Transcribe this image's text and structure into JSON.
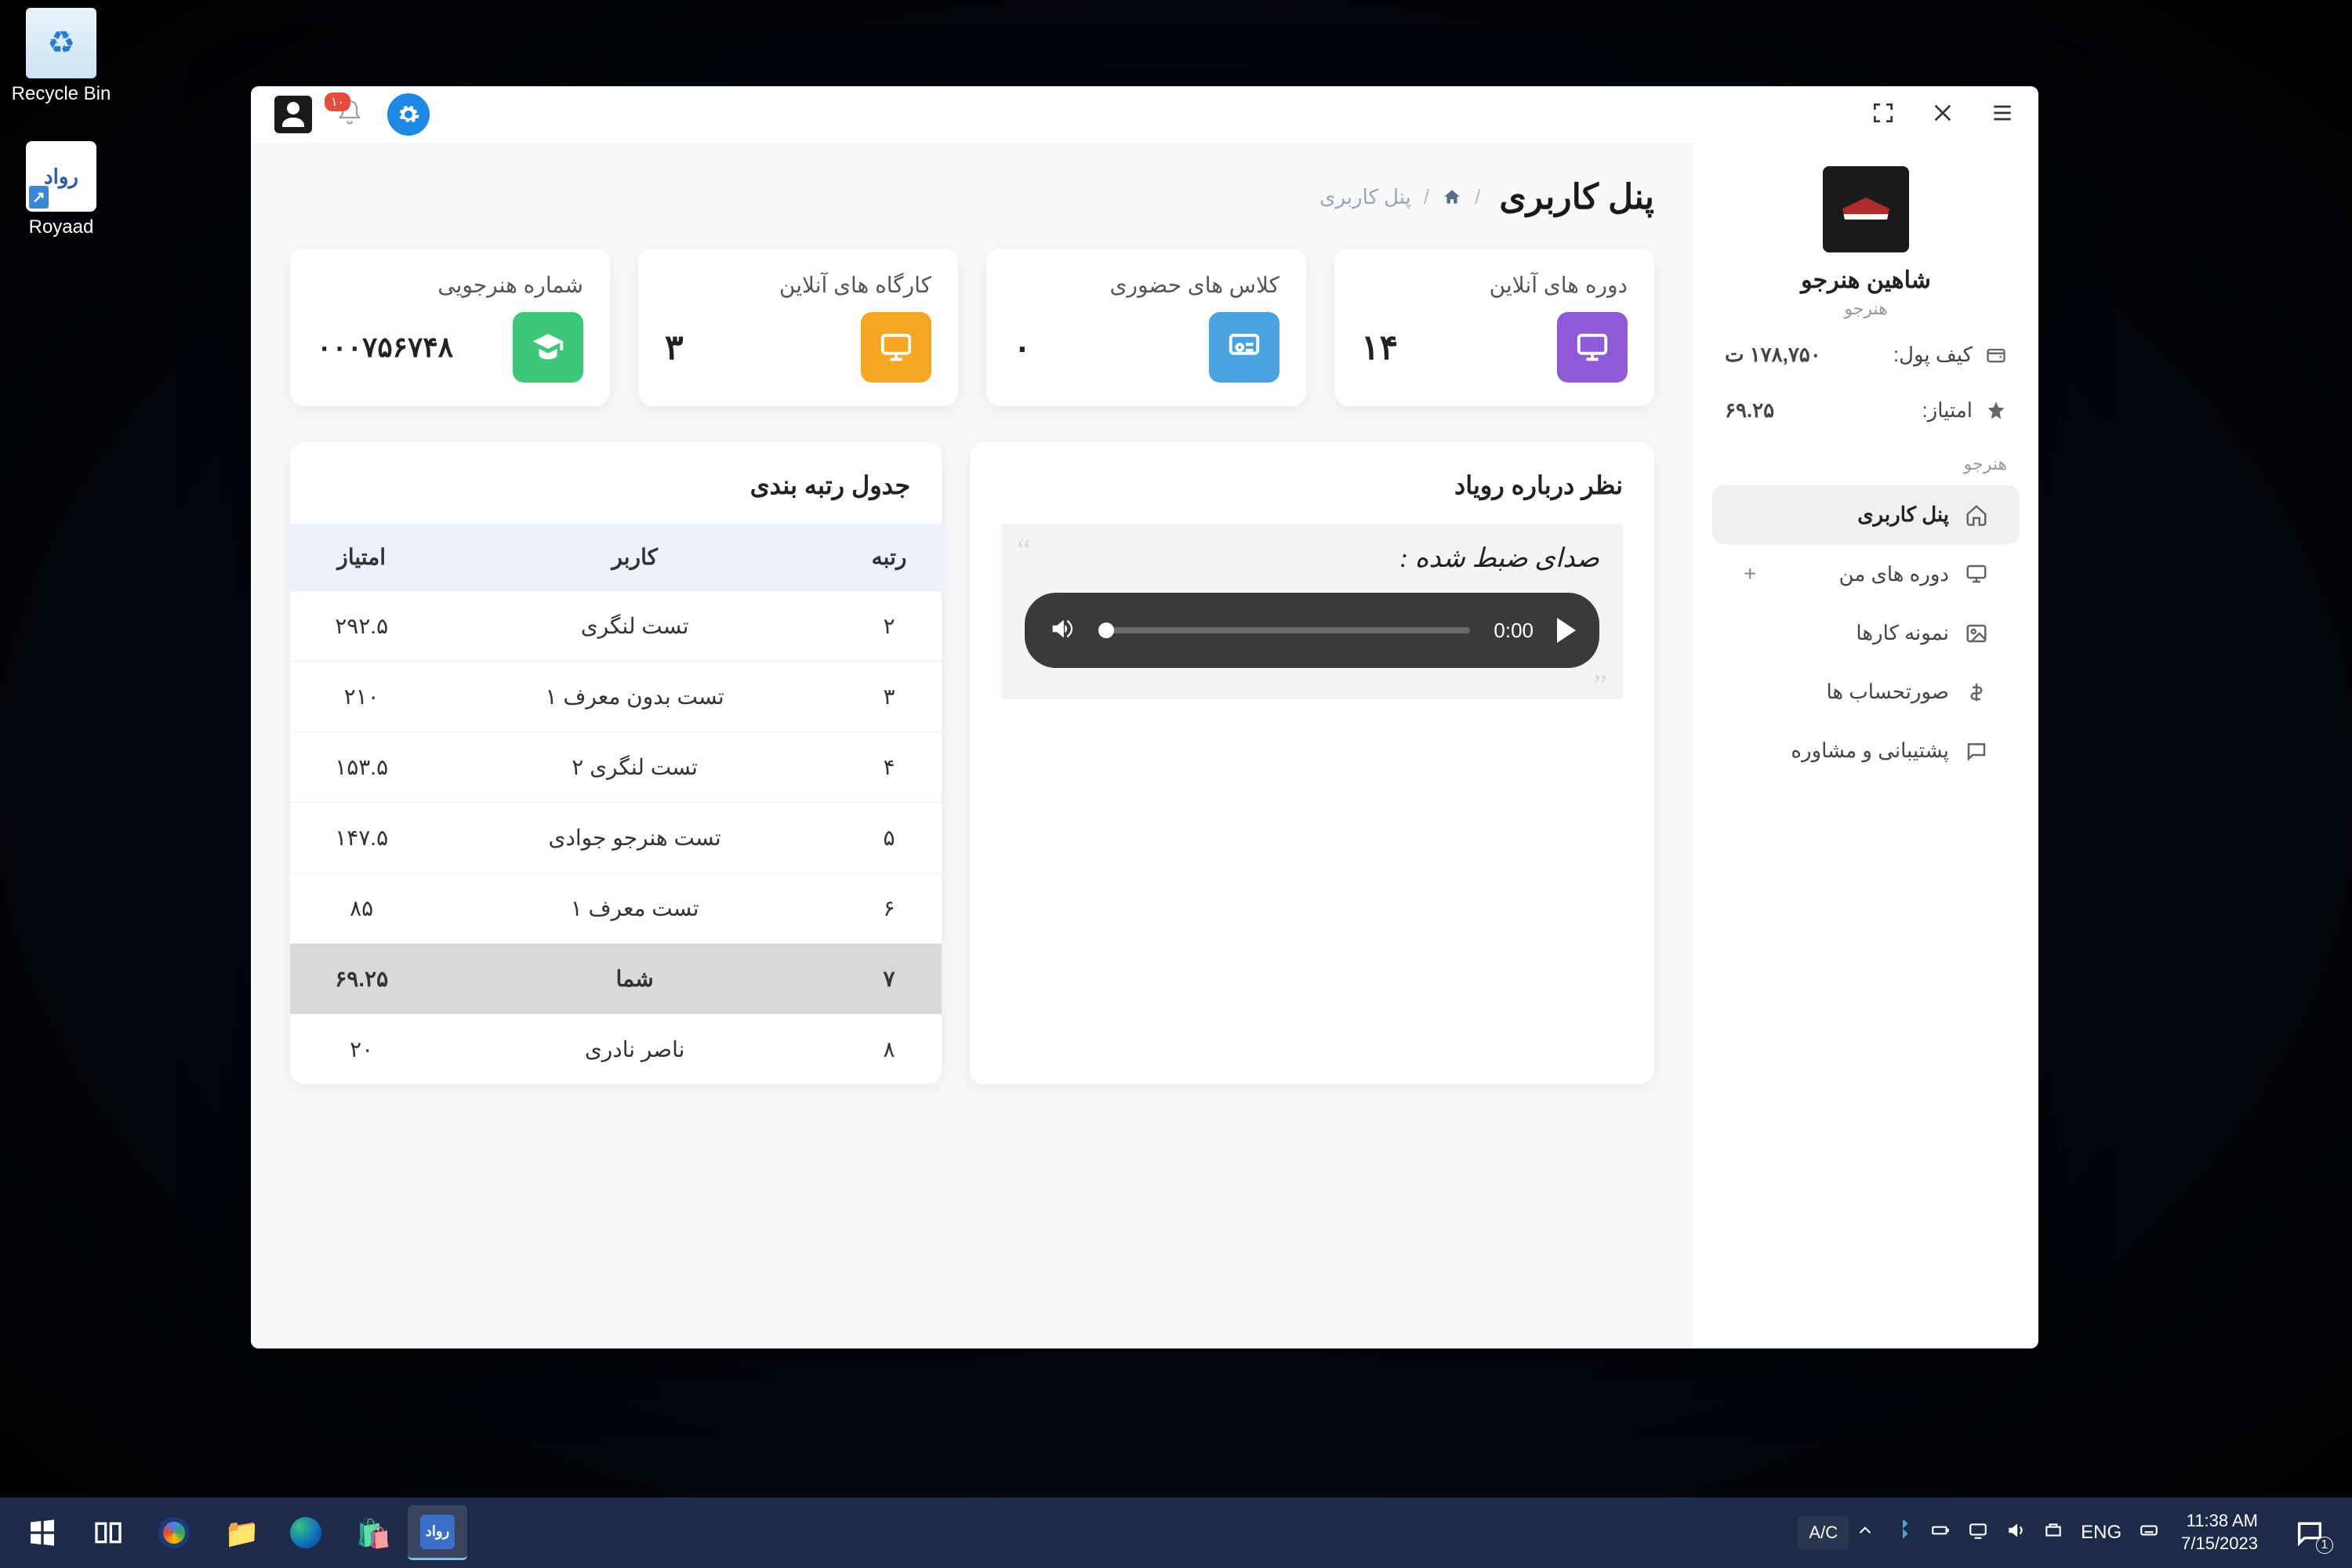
{
  "desktop": {
    "icons": [
      {
        "label": "Recycle Bin"
      },
      {
        "label": "Royaad",
        "logo_text": "رواد"
      }
    ]
  },
  "titlebar": {
    "notif_count": "۱۰"
  },
  "sidebar": {
    "user_name": "شاهین هنرجو",
    "user_role": "هنرجو",
    "wallet_label": "کیف پول:",
    "wallet_value": "۱۷۸,۷۵۰ ت",
    "points_label": "امتیاز:",
    "points_value": "۶۹.۲۵",
    "section_label": "هنرجو",
    "items": [
      {
        "label": "پنل کاربری",
        "active": true
      },
      {
        "label": "دوره های من",
        "expandable": true
      },
      {
        "label": "نمونه کارها"
      },
      {
        "label": "صورتحساب ها"
      },
      {
        "label": "پشتیبانی و مشاوره"
      }
    ]
  },
  "page": {
    "title": "پنل کاربری",
    "breadcrumb_current": "پنل کاربری"
  },
  "stats": [
    {
      "label": "دوره های آنلاین",
      "value": "۱۴",
      "color": "c-purple"
    },
    {
      "label": "کلاس های حضوری",
      "value": "۰",
      "color": "c-blue"
    },
    {
      "label": "کارگاه های آنلاین",
      "value": "۳",
      "color": "c-orange"
    },
    {
      "label": "شماره هنرجویی",
      "value": "۰۰۰۷۵۶۷۴۸",
      "color": "c-green"
    }
  ],
  "feedback": {
    "title": "نظر درباره رویاد",
    "recorded_label": "صدای ضبط شده :",
    "audio_time": "0:00"
  },
  "ranking": {
    "title": "جدول رتبه بندی",
    "headers": {
      "rank": "رتبه",
      "user": "کاربر",
      "score": "امتیاز"
    },
    "rows": [
      {
        "rank": "۲",
        "user": "تست لنگری",
        "score": "۲۹۲.۵"
      },
      {
        "rank": "۳",
        "user": "تست بدون معرف ۱",
        "score": "۲۱۰"
      },
      {
        "rank": "۴",
        "user": "تست لنگری ۲",
        "score": "۱۵۳.۵"
      },
      {
        "rank": "۵",
        "user": "تست هنرجو جوادی",
        "score": "۱۴۷.۵"
      },
      {
        "rank": "۶",
        "user": "تست معرف ۱",
        "score": "۸۵"
      },
      {
        "rank": "۷",
        "user": "شما",
        "score": "۶۹.۲۵",
        "me": true
      },
      {
        "rank": "۸",
        "user": "ناصر نادری",
        "score": "۲۰"
      }
    ]
  },
  "taskbar": {
    "weather": "A/C",
    "lang": "ENG",
    "time": "11:38 AM",
    "date": "7/15/2023",
    "notif": "1"
  }
}
